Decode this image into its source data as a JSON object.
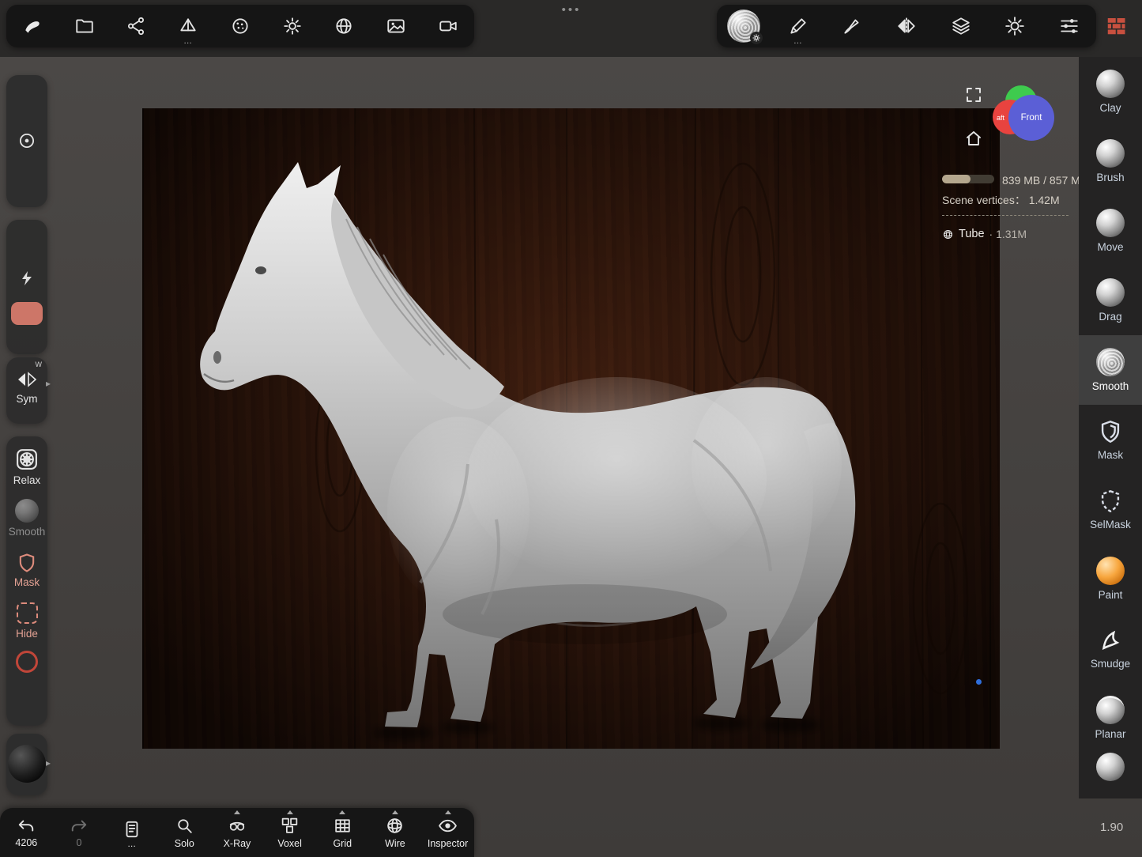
{
  "window": {
    "app": "3d-sculpt-workspace"
  },
  "top_center": {
    "dots": "•••"
  },
  "submenu_dots": "…",
  "left_toolbar": {
    "icons": [
      "app-logo",
      "files-folder",
      "node-graph",
      "scene-menu",
      "matcap-sphere",
      "lighting-sun",
      "environment-sphere",
      "background-image",
      "camera"
    ]
  },
  "right_toolbar": {
    "icons": [
      "active-tool-sphere",
      "stroke-pencil",
      "material-paintbrush",
      "symmetry-mirror",
      "layers",
      "settings-gear",
      "sliders-filter",
      "bricks-topology"
    ],
    "brick_color": "#c8503f"
  },
  "nav_gizmo": {
    "front_label": "Front",
    "left_label": "aft"
  },
  "stats": {
    "memory_text": "839 MB / 857 M",
    "scene_vertices_line": "Scene vertices： 1.42M",
    "object_name": "Tube",
    "object_vertices": "· 1.31M"
  },
  "left_panel": {
    "sym_badge": "W",
    "sym_label": "Sym",
    "relax_label": "Relax",
    "smooth_label": "Smooth",
    "mask_label": "Mask",
    "hide_label": "Hide"
  },
  "right_panel": {
    "tools": [
      {
        "name": "clay",
        "label": "Clay"
      },
      {
        "name": "brush",
        "label": "Brush"
      },
      {
        "name": "move",
        "label": "Move"
      },
      {
        "name": "drag",
        "label": "Drag"
      },
      {
        "name": "smooth",
        "label": "Smooth",
        "selected": true
      },
      {
        "name": "mask",
        "label": "Mask"
      },
      {
        "name": "selmask",
        "label": "SelMask"
      },
      {
        "name": "paint",
        "label": "Paint"
      },
      {
        "name": "smudge",
        "label": "Smudge"
      },
      {
        "name": "planar",
        "label": "Planar"
      }
    ]
  },
  "bottom_bar": {
    "undo_count": "4206",
    "redo_count": "0",
    "items": [
      {
        "name": "solo",
        "label": "Solo"
      },
      {
        "name": "xray",
        "label": "X-Ray"
      },
      {
        "name": "voxel",
        "label": "Voxel"
      },
      {
        "name": "grid",
        "label": "Grid"
      },
      {
        "name": "wire",
        "label": "Wire"
      },
      {
        "name": "inspector",
        "label": "Inspector"
      }
    ]
  },
  "status": {
    "zoom": "1.90"
  },
  "colors": {
    "salmon": "#e2a193",
    "accent_blue": "#2f6fdc",
    "selected_row": "#3f3f3f"
  }
}
